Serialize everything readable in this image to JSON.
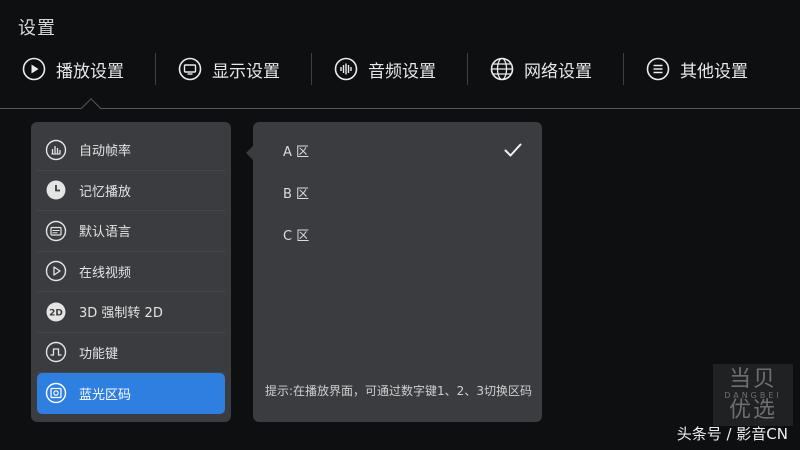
{
  "header": {
    "title": "设置"
  },
  "tabs": [
    {
      "label": "播放设置",
      "icon": "play-circle-icon"
    },
    {
      "label": "显示设置",
      "icon": "monitor-icon"
    },
    {
      "label": "音频设置",
      "icon": "audio-wave-icon"
    },
    {
      "label": "网络设置",
      "icon": "globe-icon"
    },
    {
      "label": "其他设置",
      "icon": "menu-circle-icon"
    }
  ],
  "menu": {
    "items": [
      {
        "label": "自动帧率",
        "icon": "bar-chart-icon"
      },
      {
        "label": "记忆播放",
        "icon": "clock-icon"
      },
      {
        "label": "默认语言",
        "icon": "subtitle-icon"
      },
      {
        "label": "在线视频",
        "icon": "play-circle-icon"
      },
      {
        "label": "3D 强制转 2D",
        "icon": "2d-icon"
      },
      {
        "label": "功能键",
        "icon": "pulse-key-icon"
      },
      {
        "label": "蓝光区码",
        "icon": "disc-region-icon"
      }
    ],
    "active_index": 6
  },
  "options": {
    "items": [
      {
        "label": "A 区"
      },
      {
        "label": "B 区"
      },
      {
        "label": "C 区"
      }
    ],
    "selected_index": 0,
    "hint": "提示:在播放界面，可通过数字键1、2、3切换区码"
  },
  "watermark": {
    "logo_text": "当贝",
    "logo_text2": "优选",
    "logo_sub": "DANGBEI",
    "credit": "头条号 / 影音CN"
  },
  "colors": {
    "background": "#0e0f11",
    "panel": "#3a3c40",
    "accent": "#2f7fe0"
  }
}
